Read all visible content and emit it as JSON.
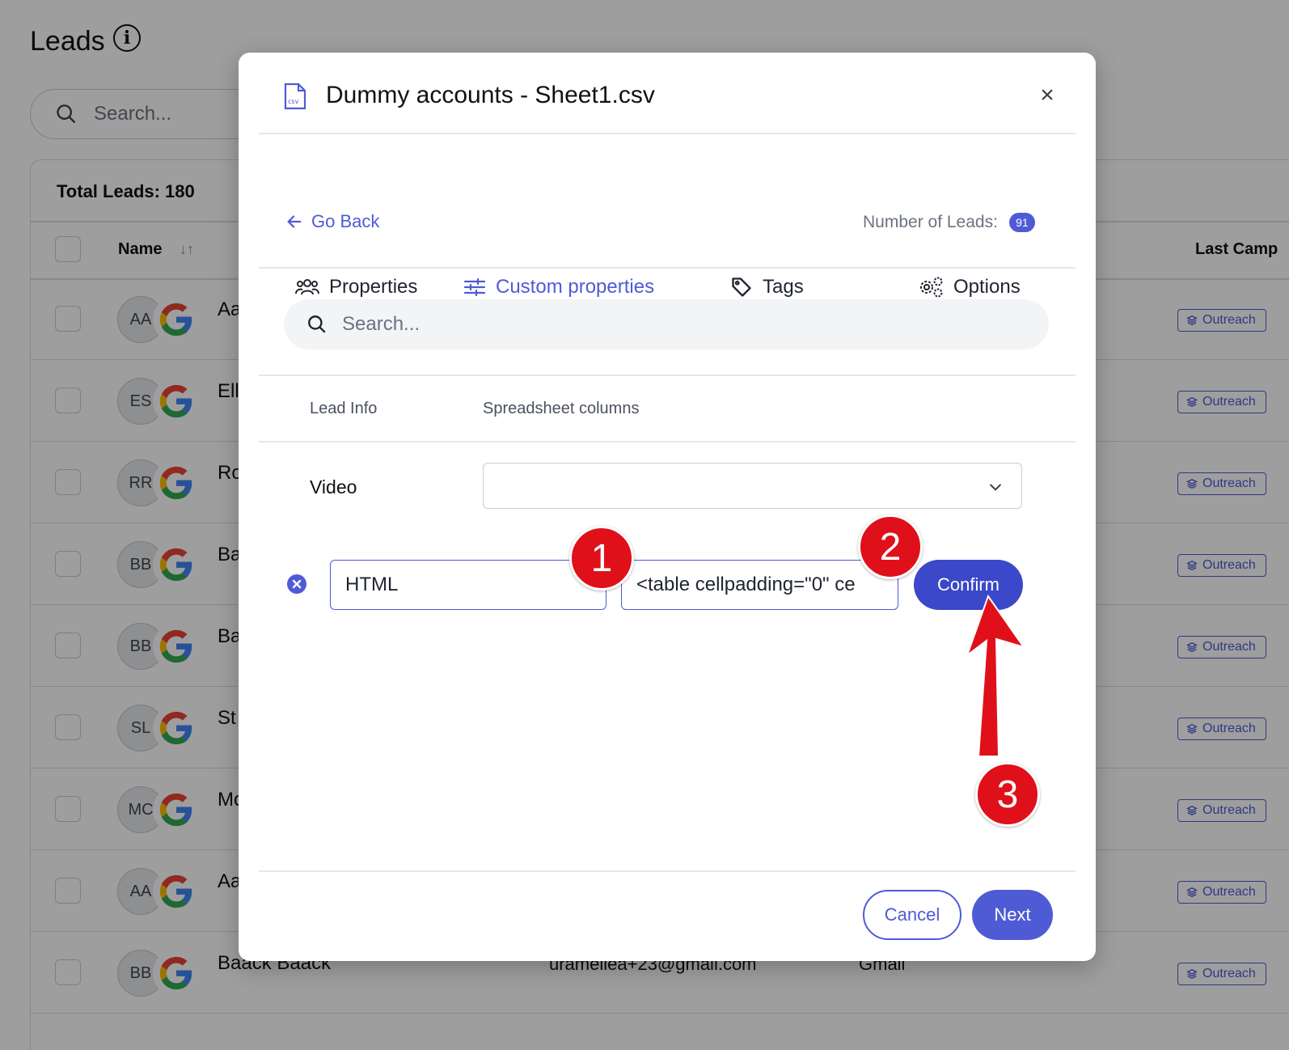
{
  "background": {
    "page_title": "Leads",
    "search_placeholder": "Search...",
    "total_leads": "Total Leads: 180",
    "columns": {
      "name": "Name",
      "last_campaign": "Last Camp"
    },
    "rows": [
      {
        "initials": "AA",
        "name": "Aa",
        "email": "",
        "source": "",
        "badge": "Outreach"
      },
      {
        "initials": "ES",
        "name": "Ell",
        "email": "",
        "source": "",
        "badge": "Outreach"
      },
      {
        "initials": "RR",
        "name": "Ro",
        "email": "",
        "source": "",
        "badge": "Outreach"
      },
      {
        "initials": "BB",
        "name": "Ba",
        "email": "",
        "source": "",
        "badge": "Outreach"
      },
      {
        "initials": "BB",
        "name": "Ba",
        "email": "",
        "source": "",
        "badge": "Outreach"
      },
      {
        "initials": "SL",
        "name": "St",
        "email": "",
        "source": "",
        "badge": "Outreach"
      },
      {
        "initials": "MC",
        "name": "Mc",
        "email": "",
        "source": "",
        "badge": "Outreach"
      },
      {
        "initials": "AA",
        "name": "Aa",
        "email": "",
        "source": "",
        "badge": "Outreach"
      },
      {
        "initials": "BB",
        "name": "Baack Baack",
        "email": "urameliea+23@gmail.com",
        "source": "Gmail",
        "badge": "Outreach"
      }
    ]
  },
  "modal": {
    "title": "Dummy accounts - Sheet1.csv",
    "go_back": "Go Back",
    "number_of_leads_label": "Number of Leads:",
    "number_of_leads": "91",
    "tabs": [
      {
        "label": "Properties"
      },
      {
        "label": "Custom properties"
      },
      {
        "label": "Tags"
      },
      {
        "label": "Options"
      }
    ],
    "active_tab": "Custom properties",
    "search_placeholder": "Search...",
    "columns": {
      "lead_info": "Lead Info",
      "spreadsheet": "Spreadsheet columns"
    },
    "mapping_rows": [
      {
        "label": "Video",
        "selected": ""
      }
    ],
    "custom_property": {
      "name_value": "HTML",
      "column_value": "<table cellpadding=\"0\" ce",
      "confirm_label": "Confirm"
    },
    "cancel_label": "Cancel",
    "next_label": "Next"
  },
  "annotations": {
    "step_1": "1",
    "step_2": "2",
    "step_3": "3",
    "color": "#e0101a"
  },
  "colors": {
    "accent": "#4f5bd5",
    "confirm": "#3b48c9",
    "overlay": "rgba(0,0,0,0.38)"
  }
}
